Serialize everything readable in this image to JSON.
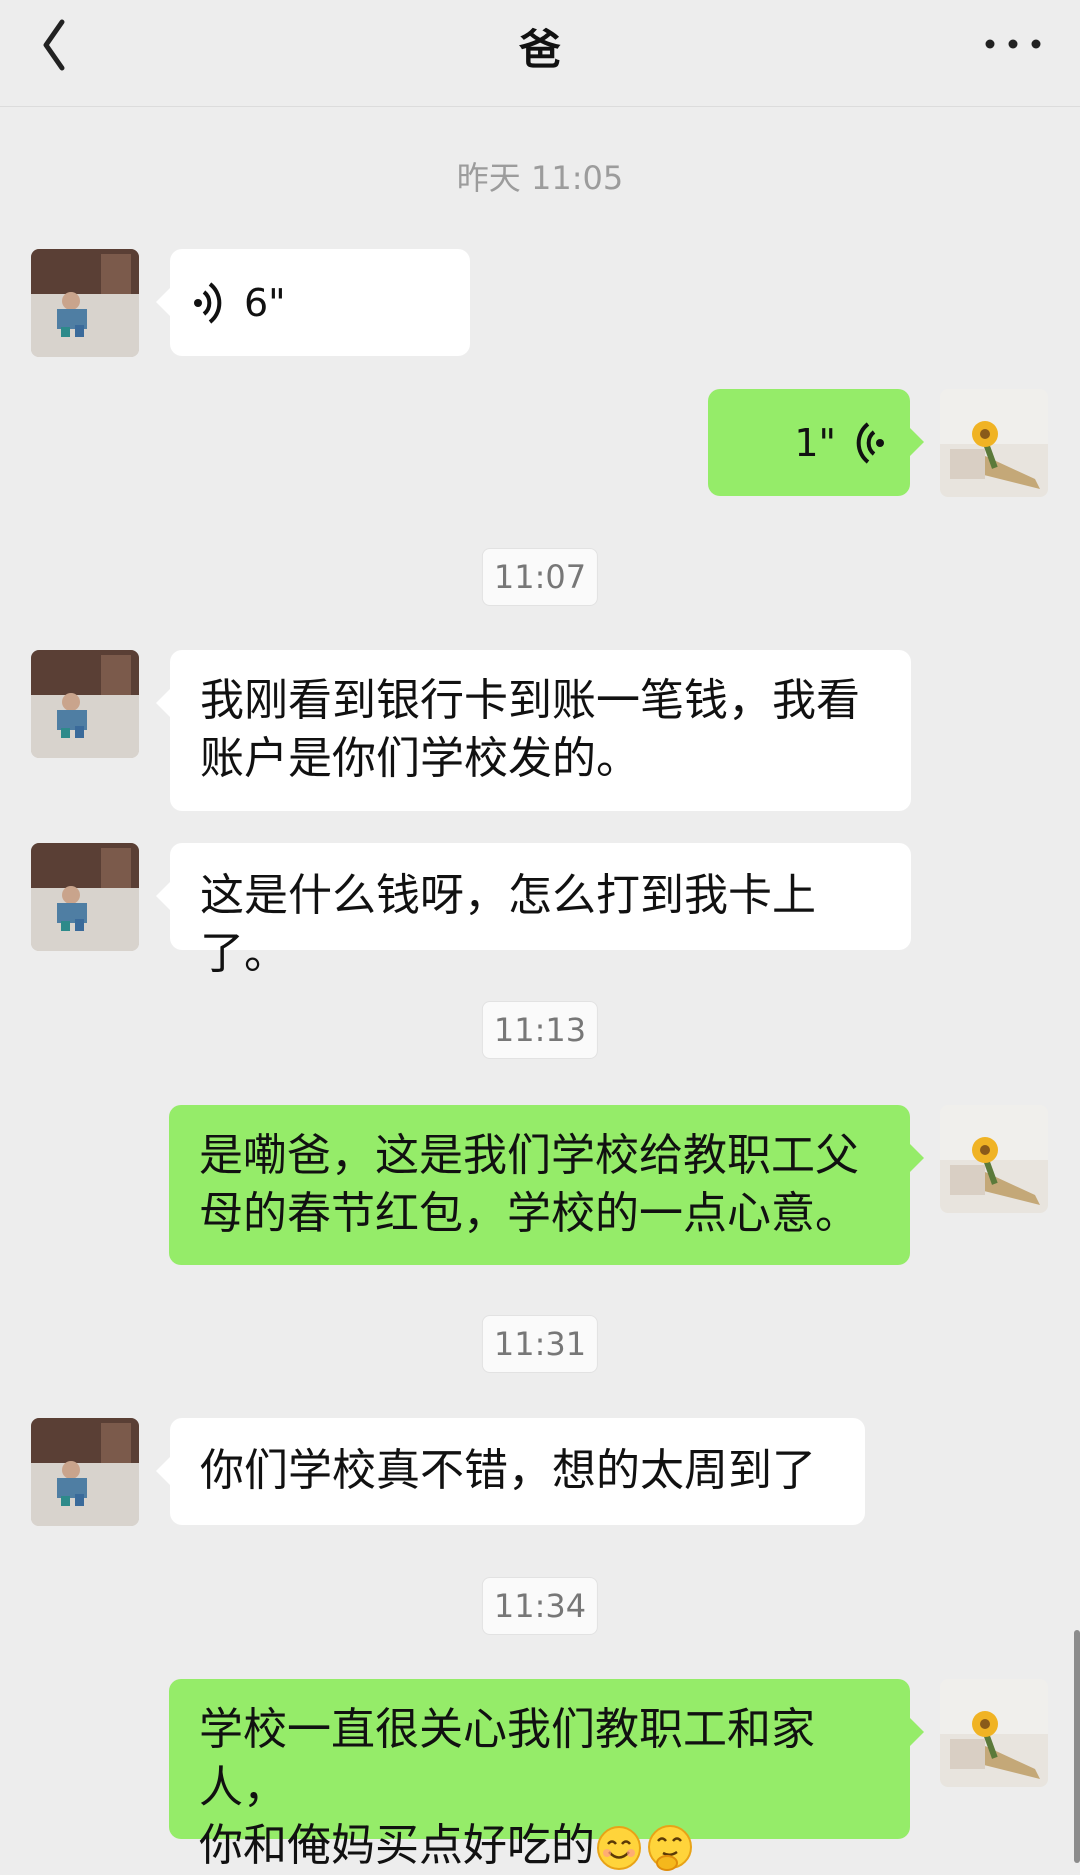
{
  "header": {
    "title": "爸"
  },
  "chat": {
    "timestamps": [
      "昨天 11:05",
      "11:07",
      "11:13",
      "11:31",
      "11:34"
    ],
    "voice_in": {
      "duration": "6\""
    },
    "voice_out": {
      "duration": "1\""
    },
    "messages": [
      {
        "from": "dad",
        "lines": [
          "我刚看到银行卡到账一笔钱，我看",
          "账户是你们学校发的。"
        ]
      },
      {
        "from": "dad",
        "lines": [
          "这是什么钱呀，怎么打到我卡上了。"
        ]
      },
      {
        "from": "me",
        "lines": [
          "是嘞爸，这是我们学校给教职工父",
          "母的春节红包，学校的一点心意。"
        ]
      },
      {
        "from": "dad",
        "lines": [
          "你们学校真不错，想的太周到了"
        ]
      },
      {
        "from": "me",
        "lines": [
          "学校一直很关心我们教职工和家人，",
          "你和俺妈买点好吃的"
        ]
      }
    ],
    "emojis": [
      "smile-emoji-icon",
      "thinking-emoji-icon"
    ]
  },
  "colors": {
    "background": "#ededed",
    "sent_bubble": "#95ec69",
    "received_bubble": "#ffffff"
  }
}
